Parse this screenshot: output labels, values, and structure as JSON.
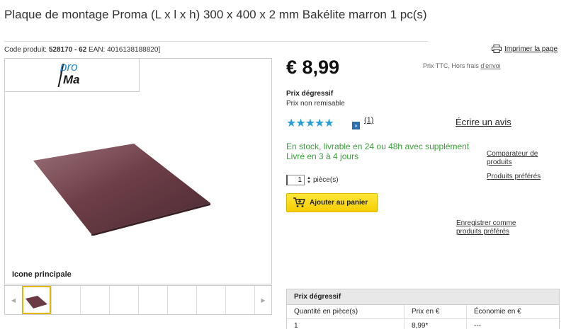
{
  "product": {
    "title": "Plaque de montage Proma (L x l x h) 300 x 400 x 2 mm Bakélite marron 1 pc(s)",
    "code_label": "Code produit:",
    "code_value": "528170 - 62",
    "ean_label": "EAN:",
    "ean_value": "4016138188820]"
  },
  "print_link": "Imprimer la page",
  "logo": {
    "line1": "pro",
    "line2": "Ma"
  },
  "image_caption": "Icone principale",
  "price": {
    "value": "€ 8,99",
    "note_prefix": "Prix TTC, Hors frais",
    "note_link": "d'envoi",
    "degressive_label": "Prix dégressif",
    "non_remisable": "Prix non remisable"
  },
  "rating": {
    "stars": "★★★★★",
    "more_icon": "»",
    "count": "(1)",
    "write_review": "Écrire un avis"
  },
  "stock": {
    "line1": "En stock, livrable en 24 ou 48h avec supplément",
    "line2": "Livré en 3 à 4 jours"
  },
  "side_links": {
    "compare": "Comparateur de produits",
    "favorites": "Produits préférés",
    "save": "Enregistrer comme produits préférés"
  },
  "quantity": {
    "value": "1",
    "unit": "pièce(s)"
  },
  "cart_button": "Ajouter au panier",
  "price_table": {
    "title": "Prix dégressif",
    "headers": [
      "Quantité en pièce(s)",
      "Prix en €",
      "Économie en €"
    ],
    "rows": [
      [
        "1",
        "8,99*",
        "---"
      ]
    ]
  },
  "colors": {
    "accent": "#2a9fd6",
    "stock_green": "#3ca03c",
    "cart_yellow": "#f6cd00",
    "plate_brown": "#6b3b44"
  }
}
